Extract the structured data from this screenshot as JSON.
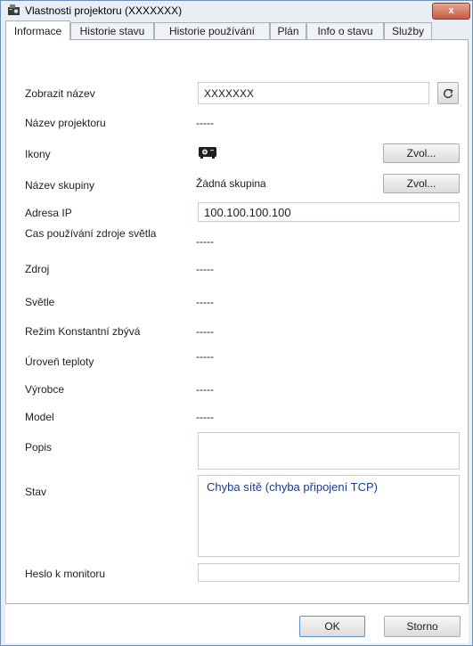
{
  "window": {
    "title": "Vlastnosti projektoru (XXXXXXX)",
    "close_label": "x"
  },
  "tabs": [
    {
      "label": "Informace"
    },
    {
      "label": "Historie stavu"
    },
    {
      "label": "Historie používání"
    },
    {
      "label": "Plán"
    },
    {
      "label": "Info o stavu"
    },
    {
      "label": "Služby"
    }
  ],
  "fields": {
    "display_name": {
      "label": "Zobrazit název",
      "value": "XXXXXXX"
    },
    "projector_name": {
      "label": "Název projektoru",
      "value": "-----"
    },
    "icons": {
      "label": "Ikony",
      "choose_label": "Zvol..."
    },
    "group_name": {
      "label": "Název skupiny",
      "value": "Žádná skupina",
      "choose_label": "Zvol..."
    },
    "ip_address": {
      "label": "Adresa IP",
      "value": "100.100.100.100"
    },
    "light_usage": {
      "label": "Cas používání zdroje světla",
      "value": "-----"
    },
    "source": {
      "label": "Zdroj",
      "value": "-----"
    },
    "brightness": {
      "label": "Světle",
      "value": "-----"
    },
    "constant_mode": {
      "label": "Režim Konstantní zbývá",
      "value": "-----"
    },
    "temperature": {
      "label": "Úroveň teploty",
      "value": "-----"
    },
    "manufacturer": {
      "label": "Výrobce",
      "value": "-----"
    },
    "model": {
      "label": "Model",
      "value": "-----"
    },
    "description": {
      "label": "Popis",
      "value": ""
    },
    "status": {
      "label": "Stav",
      "value": "Chyba sítě (chyba připojení TCP)"
    },
    "monitor_password": {
      "label": "Heslo k monitoru",
      "value": ""
    }
  },
  "buttons": {
    "ok": "OK",
    "cancel": "Storno"
  },
  "icons": {
    "refresh": "refresh-icon",
    "projector": "projector-icon",
    "app": "projector-window-icon"
  },
  "colors": {
    "status_text": "#1a3a8c",
    "accent": "#6f8fb5"
  }
}
